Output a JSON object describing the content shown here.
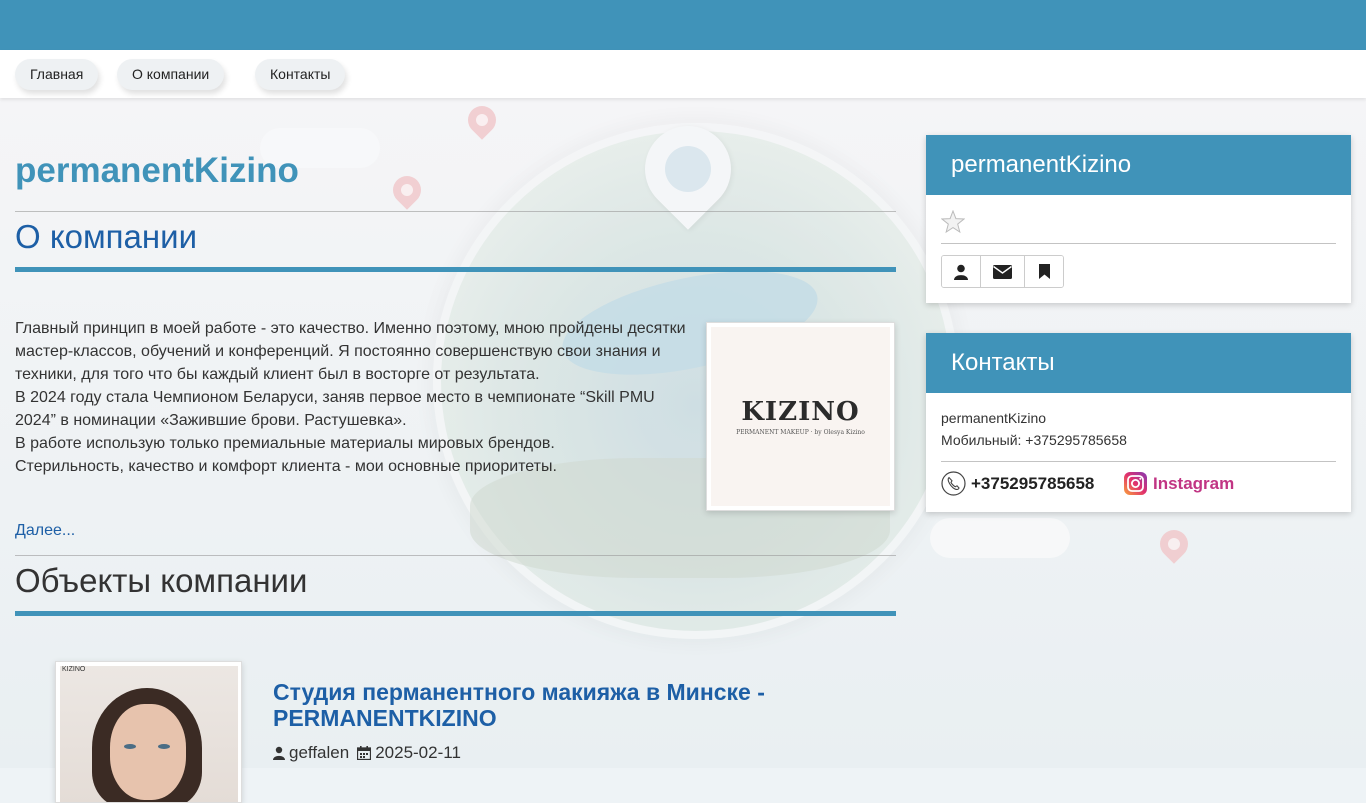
{
  "nav": {
    "items": [
      {
        "label": "Главная"
      },
      {
        "label": "О компании"
      },
      {
        "label": "Контакты"
      }
    ]
  },
  "main": {
    "company_name": "permanentKizino",
    "about_heading": "О компании",
    "about_paragraphs": [
      "Главный принцип в моей работе - это качество. Именно поэтому, мною пройдены десятки мастер-классов, обучений и конференций. Я постоянно совершенствую свои знания и техники, для того что бы каждый клиент был в восторге от результата.",
      "В 2024 году стала Чемпионом Беларуси, заняв первое место в чемпионате “Skill PMU 2024” в номинации «Зажившие брови. Растушевка».",
      "В работе использую только премиальные материалы мировых брендов.",
      "Стерильность, качество и комфорт клиента - мои основные приоритеты."
    ],
    "more_link": "Далее...",
    "logo": {
      "word": "KIZINO",
      "sub": "PERMANENT MAKEUP · by Olesya Kizino"
    },
    "objects_heading": "Объекты компании",
    "object": {
      "photo_tag": "KIZINO",
      "title": "Студия перманентного макияжа в Минске - PERMANENTKIZINO",
      "author": "geffalen",
      "date": "2025-02-11"
    }
  },
  "sidebar": {
    "profile_panel": {
      "title": "permanentKizino",
      "buttons": [
        {
          "icon": "user-icon"
        },
        {
          "icon": "envelope-icon"
        },
        {
          "icon": "bookmark-icon"
        }
      ]
    },
    "contacts_panel": {
      "title": "Контакты",
      "name": "permanentKizino",
      "mobile": "Мобильный: +375295785658",
      "phone_link": "+375295785658",
      "instagram_link": "Instagram"
    }
  },
  "colors": {
    "accent": "#4093b9",
    "link": "#1d5fa6",
    "instagram": "#c13584"
  }
}
